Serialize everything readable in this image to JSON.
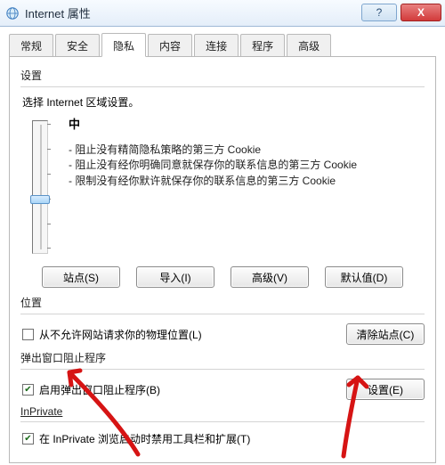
{
  "window": {
    "title": "Internet 属性",
    "help_symbol": "?",
    "close_symbol": "X"
  },
  "tabs": [
    "常规",
    "安全",
    "隐私",
    "内容",
    "连接",
    "程序",
    "高级"
  ],
  "active_tab_index": 2,
  "settings": {
    "heading": "设置",
    "prompt": "选择 Internet 区域设置。",
    "level": "中",
    "bullets": [
      "阻止没有精简隐私策略的第三方 Cookie",
      "阻止没有经你明确同意就保存你的联系信息的第三方 Cookie",
      "限制没有经你默许就保存你的联系信息的第三方 Cookie"
    ],
    "buttons": {
      "sites": "站点(S)",
      "import": "导入(I)",
      "advanced": "高级(V)",
      "default": "默认值(D)"
    }
  },
  "location": {
    "heading": "位置",
    "never_allow_label": "从不允许网站请求你的物理位置(L)",
    "never_allow_checked": false,
    "clear_sites_btn": "清除站点(C)"
  },
  "popup": {
    "heading": "弹出窗口阻止程序",
    "enable_label": "启用弹出窗口阻止程序(B)",
    "enable_checked": true,
    "settings_btn": "设置(E)"
  },
  "inprivate": {
    "heading": "InPrivate",
    "disable_toolbars_label": "在 InPrivate 浏览启动时禁用工具栏和扩展(T)",
    "disable_toolbars_checked": true
  },
  "arrow_color": "#d61414"
}
